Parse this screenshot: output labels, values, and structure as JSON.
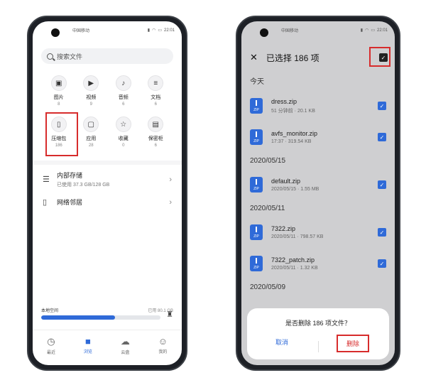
{
  "left": {
    "status": {
      "carrier": "中国移动",
      "time": "22:01"
    },
    "search": {
      "placeholder": "搜索文件"
    },
    "categories": [
      {
        "label": "图片",
        "count": "8",
        "icon": "image-icon"
      },
      {
        "label": "视频",
        "count": "9",
        "icon": "video-icon"
      },
      {
        "label": "音频",
        "count": "6",
        "icon": "music-icon"
      },
      {
        "label": "文档",
        "count": "6",
        "icon": "document-icon"
      },
      {
        "label": "压缩包",
        "count": "186",
        "icon": "zip-icon"
      },
      {
        "label": "应用",
        "count": "28",
        "icon": "app-icon"
      },
      {
        "label": "收藏",
        "count": "0",
        "icon": "star-icon"
      },
      {
        "label": "保密柜",
        "count": "6",
        "icon": "safe-icon"
      }
    ],
    "storage": {
      "internal": {
        "title": "内部存储",
        "detail": "已使用 37.3 GB/128 GB"
      },
      "network": {
        "title": "网络邻居"
      }
    },
    "bottom": {
      "recent_label": "本地空间",
      "used_text": "已用 80.1 GB",
      "progress_fraction": 0.62
    },
    "nav": [
      {
        "label": "最近",
        "icon": "clock-icon",
        "active": false
      },
      {
        "label": "浏览",
        "icon": "folder-icon",
        "active": true
      },
      {
        "label": "云盘",
        "icon": "cloud-icon",
        "active": false
      },
      {
        "label": "我的",
        "icon": "person-icon",
        "active": false
      }
    ]
  },
  "right": {
    "status": {
      "carrier": "中国移动",
      "time": "22:01"
    },
    "header": {
      "title": "已选择 186 项"
    },
    "groups": [
      {
        "date": "今天",
        "items": [
          {
            "name": "dress.zip",
            "meta": "51 分钟前 · 20.1 KB"
          },
          {
            "name": "avfs_monitor.zip",
            "meta": "17:37 · 319.54 KB"
          }
        ]
      },
      {
        "date": "2020/05/15",
        "items": [
          {
            "name": "default.zip",
            "meta": "2020/05/15 · 1.55 MB"
          }
        ]
      },
      {
        "date": "2020/05/11",
        "items": [
          {
            "name": "7322.zip",
            "meta": "2020/05/11 · 798.57 KB"
          },
          {
            "name": "7322_patch.zip",
            "meta": "2020/05/11 · 1.32 KB"
          }
        ]
      },
      {
        "date": "2020/05/09",
        "items": []
      }
    ],
    "dialog": {
      "message": "是否删除 186 项文件？",
      "cancel": "取消",
      "confirm": "删除"
    }
  }
}
